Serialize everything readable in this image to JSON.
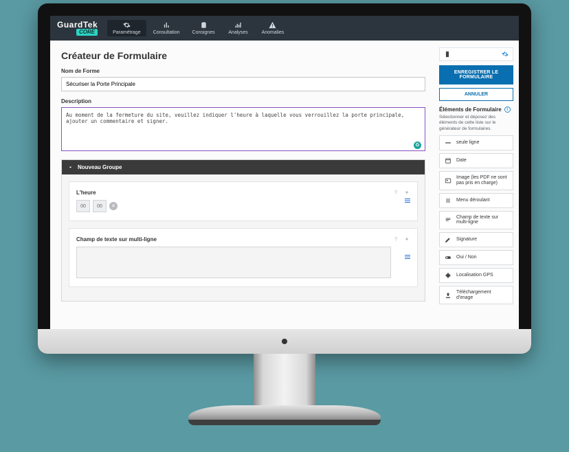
{
  "brand": {
    "name": "GuardTek",
    "sub": "CORE"
  },
  "nav": {
    "items": [
      {
        "label": "Paramétrage"
      },
      {
        "label": "Consultation"
      },
      {
        "label": "Consignes"
      },
      {
        "label": "Analyses"
      },
      {
        "label": "Anomalies"
      }
    ]
  },
  "page": {
    "title": "Créateur de Formulaire",
    "name_label": "Nom de Forme",
    "name_value": "Sécuriser la Porte Principale",
    "desc_label": "Description",
    "desc_value": "Au moment de la fermeture du site, veuillez indiquer l'heure à laquelle vous verrouillez la porte principale, ajouter un commentaire et signer."
  },
  "group": {
    "title": "Nouveau Groupe",
    "field_time_label": "L'heure",
    "time_hh": "00",
    "time_mm": "00",
    "field_multiline_label": "Champ de texte sur multi-ligne"
  },
  "side": {
    "save": "ENREGISTRER LE FORMULAIRE",
    "cancel": "ANNULER",
    "elements_title": "Éléments de Formulaire",
    "elements_help": "Sélectionner et déposez des éléments de cette liste sur le générateur de formulaires.",
    "items": [
      {
        "label": "seule ligne"
      },
      {
        "label": "Date"
      },
      {
        "label": "Image (les PDF ne sont pas pris en charge)"
      },
      {
        "label": "Menu déroulant"
      },
      {
        "label": "Champ de texte sur multi-ligne"
      },
      {
        "label": "Signature"
      },
      {
        "label": "Oui / Non"
      },
      {
        "label": "Localisation GPS"
      },
      {
        "label": "Téléchargement d'image"
      }
    ]
  }
}
